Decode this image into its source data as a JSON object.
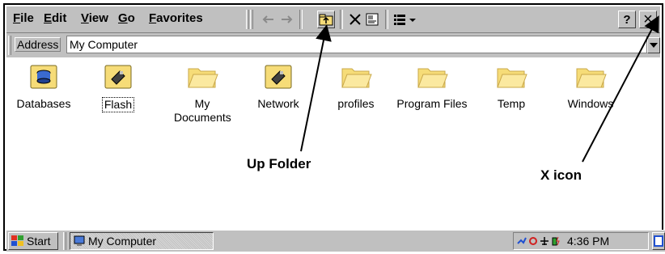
{
  "menubar": {
    "items": [
      {
        "first": "F",
        "rest": "ile"
      },
      {
        "first": "E",
        "rest": "dit"
      },
      {
        "first": "V",
        "rest": "iew"
      },
      {
        "first": "G",
        "rest": "o"
      },
      {
        "first": "F",
        "rest": "avorites"
      }
    ],
    "help_label": "?",
    "close_label": "×"
  },
  "address": {
    "label": "Address",
    "value": "My Computer"
  },
  "items": [
    {
      "label": "Databases",
      "icon": "database-folder-icon"
    },
    {
      "label": "Flash",
      "icon": "flash-storage-icon",
      "selected": true
    },
    {
      "label": "My Documents",
      "icon": "folder-icon"
    },
    {
      "label": "Network",
      "icon": "network-drive-icon"
    },
    {
      "label": "profiles",
      "icon": "folder-icon"
    },
    {
      "label": "Program Files",
      "icon": "folder-icon"
    },
    {
      "label": "Temp",
      "icon": "folder-icon"
    },
    {
      "label": "Windows",
      "icon": "folder-icon"
    }
  ],
  "annotations": {
    "up_folder": "Up Folder",
    "x_icon": "X icon"
  },
  "taskbar": {
    "start_label": "Start",
    "task_label": "My Computer",
    "clock": "4:36 PM"
  },
  "colors": {
    "chrome": "#c0c0c0",
    "folder_yellow": "#f6dc78",
    "accent_blue": "#1050c0"
  }
}
